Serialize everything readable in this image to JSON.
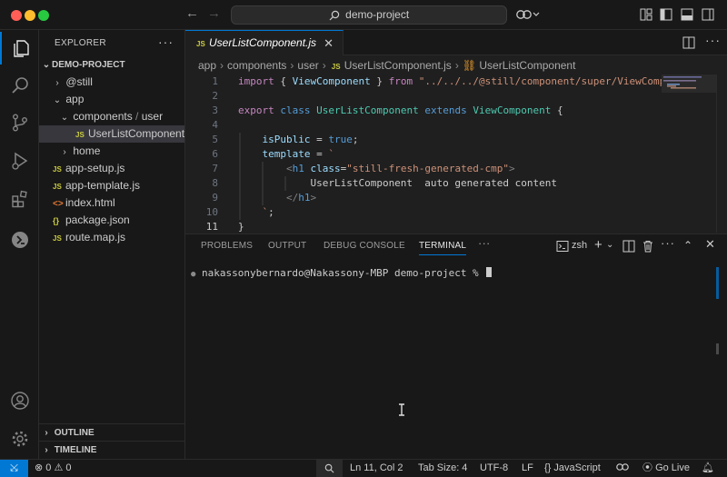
{
  "titlebar": {
    "search_text": "demo-project"
  },
  "sidebar": {
    "title": "EXPLORER",
    "root": "DEMO-PROJECT",
    "items": [
      {
        "label": "@still",
        "type": "folder",
        "depth": 1,
        "expanded": false
      },
      {
        "label": "app",
        "type": "folder",
        "depth": 1,
        "expanded": true
      },
      {
        "label": "components",
        "type": "folder",
        "depth": 2,
        "expanded": true,
        "compact": "user"
      },
      {
        "label": "UserListComponent.js",
        "type": "js",
        "depth": 3,
        "selected": true
      },
      {
        "label": "home",
        "type": "folder",
        "depth": 2,
        "expanded": false
      },
      {
        "label": "app-setup.js",
        "type": "js",
        "depth": 1
      },
      {
        "label": "app-template.js",
        "type": "js",
        "depth": 1
      },
      {
        "label": "index.html",
        "type": "html",
        "depth": 1
      },
      {
        "label": "package.json",
        "type": "json",
        "depth": 1
      },
      {
        "label": "route.map.js",
        "type": "js",
        "depth": 1
      }
    ],
    "sections": [
      "OUTLINE",
      "TIMELINE"
    ]
  },
  "editor": {
    "tab_label": "UserListComponent.js",
    "file_badge": "JS",
    "breadcrumb": [
      "app",
      "components",
      "user",
      "UserListComponent.js",
      "UserListComponent"
    ],
    "line_numbers": [
      "1",
      "2",
      "3",
      "4",
      "5",
      "6",
      "7",
      "8",
      "9",
      "10",
      "11"
    ],
    "current_line": 11
  },
  "code_lines": [
    [
      [
        "kw2",
        "import"
      ],
      [
        "txt",
        " { "
      ],
      [
        "var",
        "ViewComponent"
      ],
      [
        "txt",
        " } "
      ],
      [
        "kw2",
        "from"
      ],
      [
        "txt",
        " "
      ],
      [
        "str",
        "\"../../../@still/component/super/ViewComponent\""
      ]
    ],
    [],
    [
      [
        "kw2",
        "export"
      ],
      [
        "txt",
        " "
      ],
      [
        "kw",
        "class"
      ],
      [
        "txt",
        " "
      ],
      [
        "cls",
        "UserListComponent"
      ],
      [
        "txt",
        " "
      ],
      [
        "kw",
        "extends"
      ],
      [
        "txt",
        " "
      ],
      [
        "cls",
        "ViewComponent"
      ],
      [
        "txt",
        " {"
      ]
    ],
    [],
    [
      [
        "txt",
        "    "
      ],
      [
        "var",
        "isPublic"
      ],
      [
        "txt",
        " = "
      ],
      [
        "kw",
        "true"
      ],
      [
        "txt",
        ";"
      ]
    ],
    [
      [
        "txt",
        "    "
      ],
      [
        "var",
        "template"
      ],
      [
        "txt",
        " = "
      ],
      [
        "str",
        "`"
      ]
    ],
    [
      [
        "txt",
        "        "
      ],
      [
        "punc",
        "<"
      ],
      [
        "tag",
        "h1"
      ],
      [
        "txt",
        " "
      ],
      [
        "attr",
        "class"
      ],
      [
        "txt",
        "="
      ],
      [
        "str",
        "\"still-fresh-generated-cmp\""
      ],
      [
        "punc",
        ">"
      ]
    ],
    [
      [
        "txt",
        "            UserListComponent  auto generated content"
      ]
    ],
    [
      [
        "txt",
        "        "
      ],
      [
        "punc",
        "</"
      ],
      [
        "tag",
        "h1"
      ],
      [
        "punc",
        ">"
      ]
    ],
    [
      [
        "txt",
        "    "
      ],
      [
        "str",
        "`"
      ],
      [
        "txt",
        ";"
      ]
    ],
    [
      [
        "txt",
        "}"
      ]
    ]
  ],
  "panel": {
    "tabs": [
      "PROBLEMS",
      "OUTPUT",
      "DEBUG CONSOLE",
      "TERMINAL"
    ],
    "active_tab": "TERMINAL",
    "shell": "zsh",
    "prompt": "nakassonybernardo@Nakassony-MBP demo-project % "
  },
  "statusbar": {
    "errors": "0",
    "warnings": "0",
    "position": "Ln 11, Col 2",
    "tab_size": "Tab Size: 4",
    "encoding": "UTF-8",
    "eol": "LF",
    "language": "JavaScript",
    "live": "Go Live"
  },
  "colors": {
    "accent": "#0078d4",
    "background": "#1f1f1f",
    "sidebar": "#181818"
  }
}
